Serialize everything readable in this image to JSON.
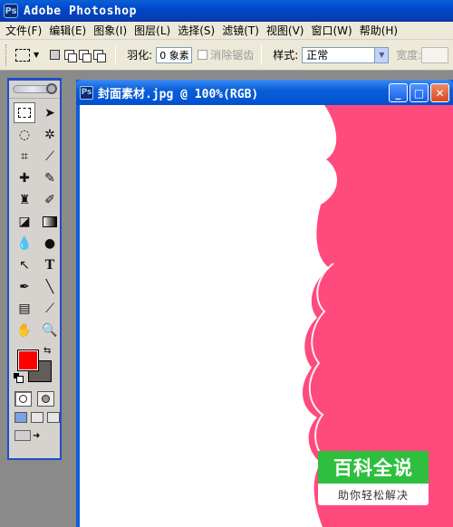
{
  "app": {
    "title": "Adobe Photoshop",
    "icon_glyph": "Ps"
  },
  "menu": [
    "文件(F)",
    "编辑(E)",
    "图象(I)",
    "图层(L)",
    "选择(S)",
    "滤镜(T)",
    "视图(V)",
    "窗口(W)",
    "帮助(H)"
  ],
  "options": {
    "feather_label": "羽化:",
    "feather_value": "0 象素",
    "antialias_label": "消除锯齿",
    "style_label": "样式:",
    "style_value": "正常",
    "width_label": "宽度:"
  },
  "tools": {
    "items": [
      "marquee-tool",
      "move-tool",
      "lasso-tool",
      "magic-wand-tool",
      "crop-tool",
      "slice-tool",
      "healing-brush-tool",
      "brush-tool",
      "clone-stamp-tool",
      "history-brush-tool",
      "eraser-tool",
      "gradient-tool",
      "blur-tool",
      "dodge-tool",
      "path-selection-tool",
      "type-tool",
      "pen-tool",
      "line-tool",
      "notes-tool",
      "eyedropper-tool",
      "hand-tool",
      "zoom-tool"
    ],
    "foreground_color": "#ff0000",
    "background_color": "#625d57"
  },
  "document": {
    "title": "封面素材.jpg @ 100%(RGB)",
    "shape_color": "#ff4a7d"
  },
  "watermark": {
    "top": "百科全说",
    "bottom": "助你轻松解决",
    "color": "#2fbf3f"
  }
}
